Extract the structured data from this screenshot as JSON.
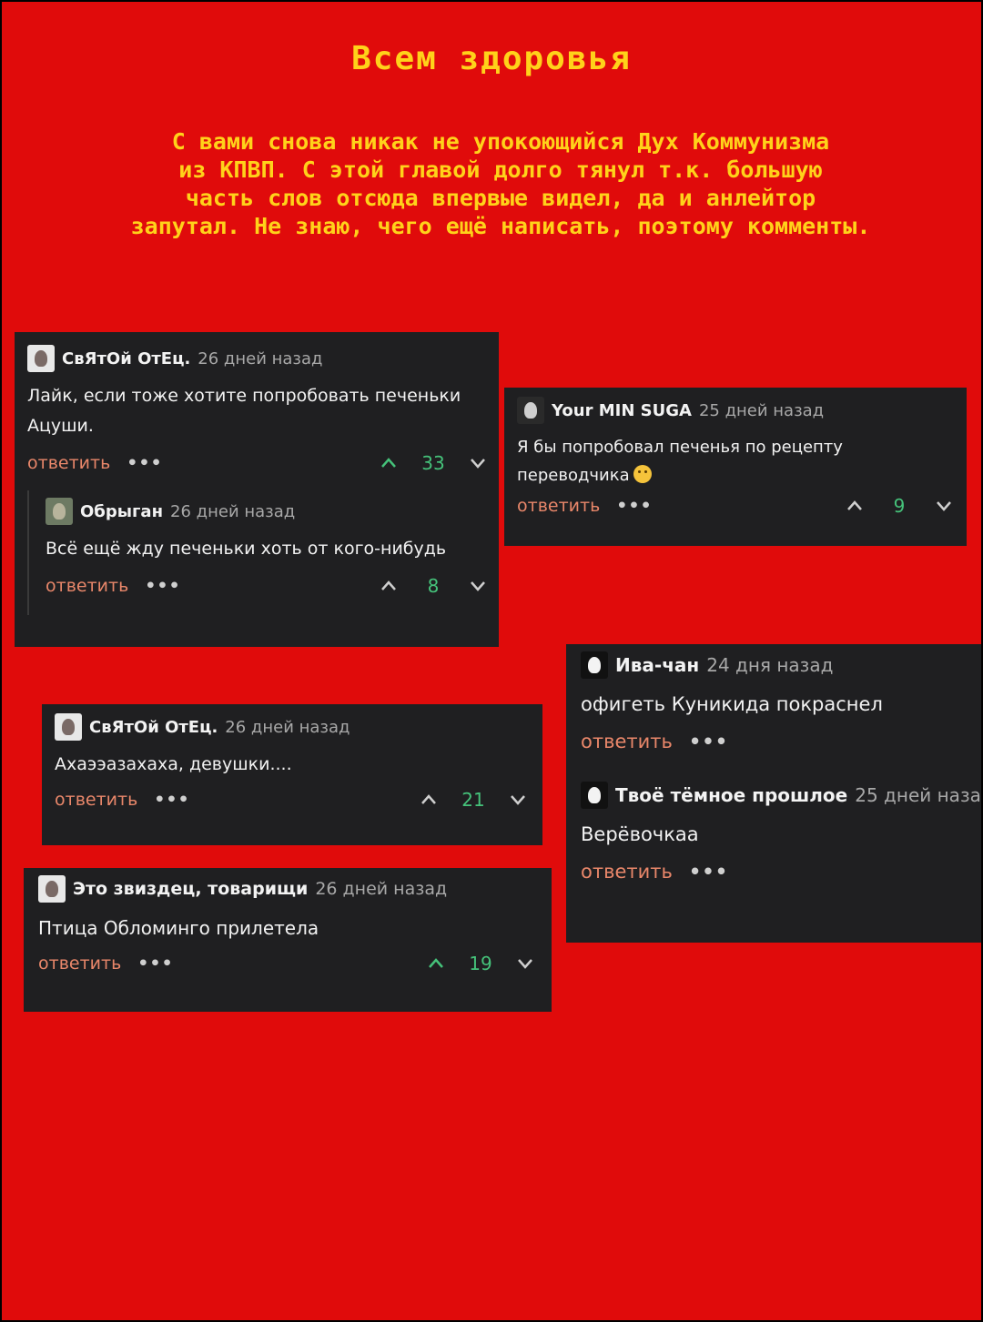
{
  "title": "Всем здоровья",
  "intro": "С вами снова никак не упокоющийся Дух Коммунизма\nиз КПВП. С этой главой долго тянул т.к. большую\nчасть слов отсюда впервые видел, да и анлейтор\nзапутал. Не знаю, чего ещё написать, поэтому комменты.",
  "colors": {
    "background": "#e00b0b",
    "title": "#ffd21a",
    "card": "#1f1f21",
    "reply": "#e9876a",
    "score": "#45c27a"
  },
  "reply_label": "ответить",
  "more_label": "•••",
  "comment1": {
    "author": "СвЯтОй ОтЕц.",
    "time": "26 дней назад",
    "text": "Лайк, если тоже хотите попробовать печеньки Ацуши.",
    "score": "33",
    "reply": {
      "author": "Обрыган",
      "time": "26 дней назад",
      "text": "Всё ещё жду печеньки хоть от кого-нибудь",
      "score": "8"
    }
  },
  "comment2": {
    "author": "Your MIN SUGA",
    "time": "25 дней назад",
    "text": "Я бы попробовал печенья по рецепту переводчика",
    "emoji": "thinking-face-emoji",
    "score": "9"
  },
  "comment3": {
    "author": "Ива-чан",
    "time": "24 дня назад",
    "text": "офигеть Куникида покраснел",
    "reply": {
      "author": "Твоё тёмное прошлое",
      "time": "25 дней наза",
      "text": "Верёвочкаа"
    }
  },
  "comment4": {
    "author": "СвЯтОй ОтЕц.",
    "time": "26 дней назад",
    "text": "Ахаээазахаха, девушки....",
    "score": "21"
  },
  "comment5": {
    "author": "Это звиздец, товарищи",
    "time": "26 дней назад",
    "text": "Птица Обломинго прилетела",
    "score": "19"
  }
}
